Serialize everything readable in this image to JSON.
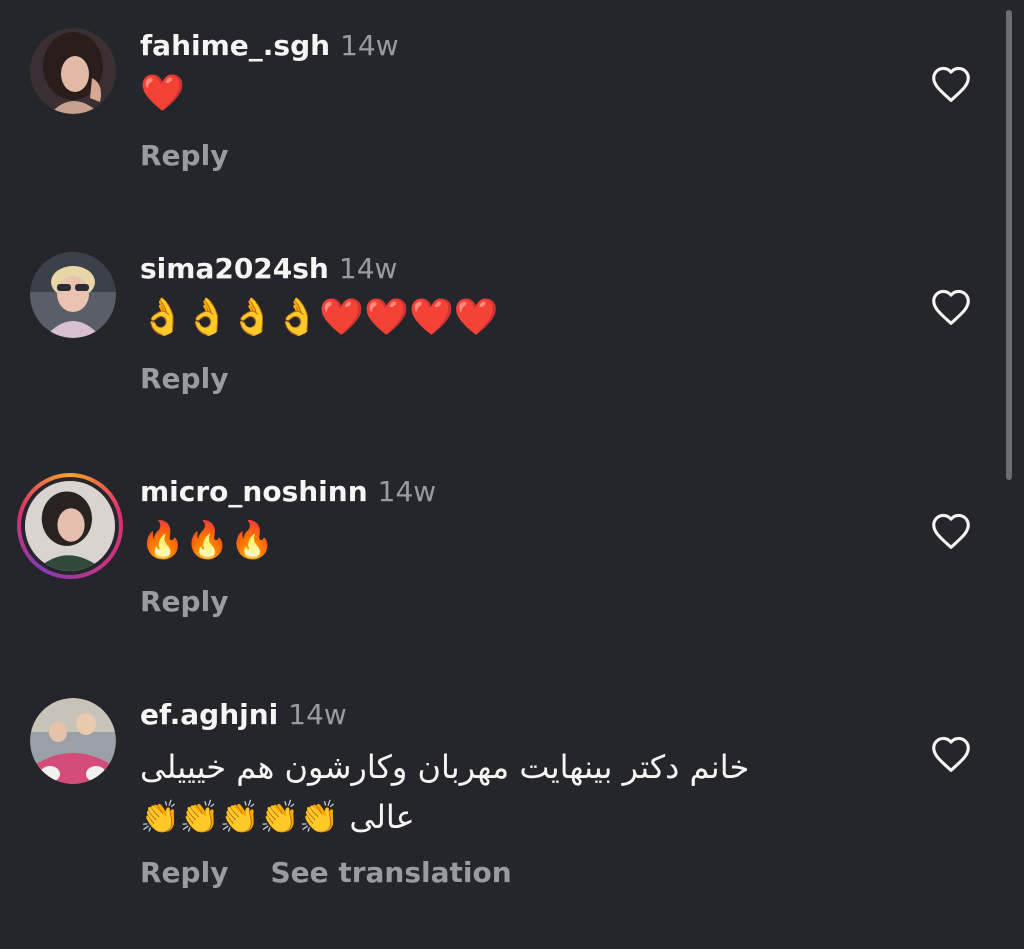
{
  "colors": {
    "background": "#25262b",
    "text_primary": "#f5f5f5",
    "text_secondary": "#9a9ba0",
    "story_ring": "#e1306c"
  },
  "icons": {
    "like": "heart-outline-icon"
  },
  "comments": [
    {
      "username": "fahime_.sgh",
      "time": "14w",
      "text": "❤️",
      "reply_label": "Reply",
      "has_story_ring": false
    },
    {
      "username": "sima2024sh",
      "time": "14w",
      "text": "👌👌👌👌❤️❤️❤️❤️",
      "reply_label": "Reply",
      "has_story_ring": false
    },
    {
      "username": "micro_noshinn",
      "time": "14w",
      "text": "🔥🔥🔥",
      "reply_label": "Reply",
      "has_story_ring": true
    },
    {
      "username": "ef.aghjni",
      "time": "14w",
      "text_line1": "خانم دکتر  بینهایت مهربان وکارشون هم خیییلی",
      "text_line2": "عالی 👏👏👏👏👏",
      "reply_label": "Reply",
      "translate_label": "See translation",
      "has_story_ring": false
    }
  ]
}
